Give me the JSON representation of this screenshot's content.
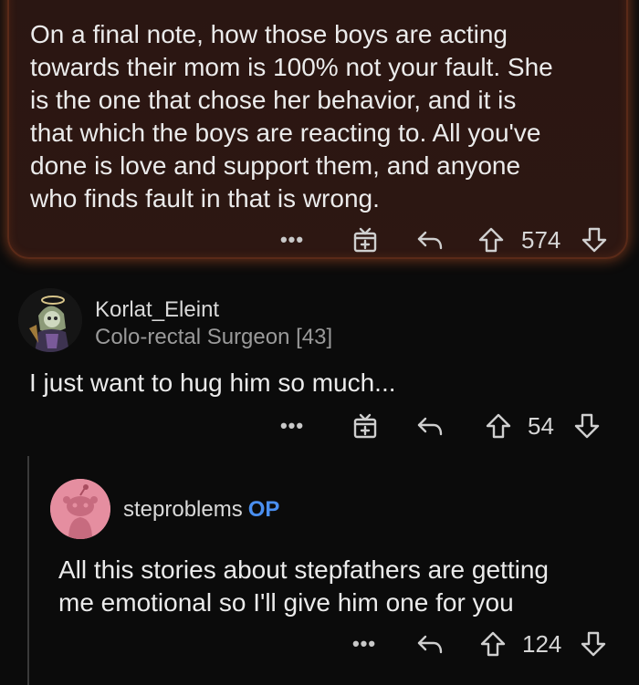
{
  "highlighted_comment": {
    "body": "On a final note, how those boys are acting\ntowards their mom is 100% not your fault. She\nis the one that chose her behavior, and it is\nthat which the boys are reacting to. All you've\ndone is love and support them, and anyone\nwho finds fault in that is wrong.",
    "more_label": "•••",
    "vote_count": "574"
  },
  "comment_1": {
    "username": "Korlat_Eleint",
    "flair": "Colo-rectal Surgeon [43]",
    "body": "I just want to hug him so much...",
    "more_label": "•••",
    "vote_count": "54"
  },
  "comment_2": {
    "username": "steproblems",
    "op_badge": "OP",
    "body": "All this stories about stepfathers are getting\nme emotional so I'll give him one for you",
    "more_label": "•••",
    "vote_count": "124"
  },
  "colors": {
    "background": "#0b0b0b",
    "highlight_glow": "#d6602c",
    "op_badge": "#4a8ff0",
    "avatar_pink": "#e58ea0"
  },
  "icons": {
    "more": "more-dots-icon",
    "award": "award-gift-icon",
    "reply": "reply-arrow-icon",
    "upvote": "upvote-arrow-icon",
    "downvote": "downvote-arrow-icon"
  }
}
